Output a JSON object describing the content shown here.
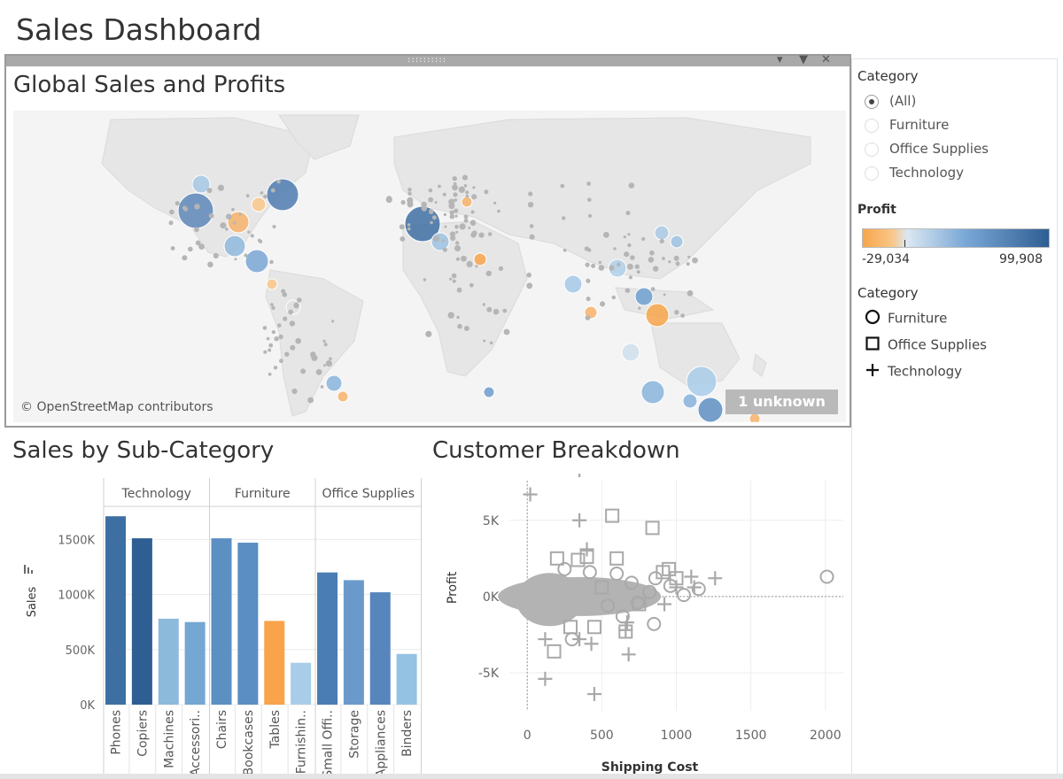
{
  "dashboard": {
    "title": "Sales Dashboard"
  },
  "map_pane": {
    "title": "Global Sales and Profits",
    "credit": "© OpenStreetMap contributors",
    "unknown_badge": "1 unknown",
    "grip": "::::::::::",
    "icons": [
      "dropdown-arrow-icon",
      "filter-icon",
      "close-icon"
    ]
  },
  "filters": {
    "category_heading": "Category",
    "options": [
      {
        "label": "(All)",
        "selected": true
      },
      {
        "label": "Furniture",
        "selected": false
      },
      {
        "label": "Office Supplies",
        "selected": false
      },
      {
        "label": "Technology",
        "selected": false
      }
    ]
  },
  "profit_legend": {
    "heading": "Profit",
    "min_label": "-29,034",
    "max_label": "99,908",
    "colors": [
      "#f7a54a",
      "#dbe7f2",
      "#2f5e93"
    ]
  },
  "shape_legend": {
    "heading": "Category",
    "items": [
      {
        "label": "Furniture",
        "shape": "circle-icon"
      },
      {
        "label": "Office Supplies",
        "shape": "square-icon"
      },
      {
        "label": "Technology",
        "shape": "plus-icon"
      }
    ]
  },
  "bar_section": {
    "title": "Sales by Sub-Category"
  },
  "scatter_section": {
    "title": "Customer Breakdown"
  },
  "chart_data": [
    {
      "type": "bar",
      "ylabel": "Sales",
      "ylim": [
        0,
        1800000
      ],
      "y_ticks": [
        {
          "value": 0,
          "label": "0K"
        },
        {
          "value": 500000,
          "label": "500K"
        },
        {
          "value": 1000000,
          "label": "1000K"
        },
        {
          "value": 1500000,
          "label": "1500K"
        }
      ],
      "groups": [
        {
          "name": "Technology",
          "items": [
            {
              "label": "Phones",
              "value": 1710000,
              "color": "#3e6fa3"
            },
            {
              "label": "Copiers",
              "value": 1510000,
              "color": "#2f5e93"
            },
            {
              "label": "Machines",
              "value": 780000,
              "color": "#8cbadb"
            },
            {
              "label": "Accessori..",
              "value": 750000,
              "color": "#74a7d2"
            }
          ]
        },
        {
          "name": "Furniture",
          "items": [
            {
              "label": "Chairs",
              "value": 1510000,
              "color": "#5c8fc2"
            },
            {
              "label": "Bookcases",
              "value": 1470000,
              "color": "#5b8ec2"
            },
            {
              "label": "Tables",
              "value": 760000,
              "color": "#f9a34b"
            },
            {
              "label": "Furnishin..",
              "value": 380000,
              "color": "#a9cde8"
            }
          ]
        },
        {
          "name": "Office Supplies",
          "items": [
            {
              "label": "Small Offi..",
              "value": 1200000,
              "color": "#4a7db3"
            },
            {
              "label": "Storage",
              "value": 1130000,
              "color": "#6a9acb"
            },
            {
              "label": "Appliances",
              "value": 1020000,
              "color": "#5786bd"
            },
            {
              "label": "Binders",
              "value": 460000,
              "color": "#94c2e3"
            }
          ]
        }
      ]
    },
    {
      "type": "scatter",
      "xlabel": "Shipping Cost",
      "ylabel": "Profit",
      "xlim": [
        -120,
        2120
      ],
      "ylim": [
        -7500,
        7600
      ],
      "x_ticks": [
        {
          "value": 0,
          "label": "0"
        },
        {
          "value": 500,
          "label": "500"
        },
        {
          "value": 1000,
          "label": "1000"
        },
        {
          "value": 1500,
          "label": "1500"
        },
        {
          "value": 2000,
          "label": "2000"
        }
      ],
      "y_ticks": [
        {
          "value": 5000,
          "label": "5K"
        },
        {
          "value": 0,
          "label": "0K"
        },
        {
          "value": -5000,
          "label": "-5K"
        }
      ],
      "series": [
        {
          "name": "Furniture",
          "shape": "circle",
          "points": [
            [
              2010,
              1300
            ],
            [
              960,
              700
            ],
            [
              1150,
              500
            ],
            [
              860,
              1200
            ],
            [
              740,
              -400
            ],
            [
              850,
              -1800
            ],
            [
              540,
              -600
            ],
            [
              640,
              -1300
            ],
            [
              300,
              -2800
            ],
            [
              250,
              1800
            ],
            [
              420,
              1600
            ],
            [
              700,
              900
            ],
            [
              820,
              300
            ],
            [
              1050,
              100
            ],
            [
              600,
              1500
            ]
          ]
        },
        {
          "name": "Office Supplies",
          "shape": "square",
          "points": [
            [
              570,
              5300
            ],
            [
              840,
              4500
            ],
            [
              400,
              2600
            ],
            [
              200,
              2500
            ],
            [
              600,
              2500
            ],
            [
              1000,
              1200
            ],
            [
              910,
              1600
            ],
            [
              950,
              1800
            ],
            [
              290,
              -2000
            ],
            [
              180,
              -3600
            ],
            [
              450,
              -2000
            ],
            [
              750,
              -500
            ],
            [
              660,
              -2300
            ],
            [
              340,
              2400
            ],
            [
              500,
              600
            ]
          ]
        },
        {
          "name": "Technology",
          "shape": "plus",
          "points": [
            [
              350,
              8300
            ],
            [
              20,
              6700
            ],
            [
              350,
              5000
            ],
            [
              400,
              3100
            ],
            [
              1000,
              600
            ],
            [
              1100,
              1300
            ],
            [
              1260,
              1200
            ],
            [
              1120,
              600
            ],
            [
              660,
              -2200
            ],
            [
              670,
              -1700
            ],
            [
              680,
              -3800
            ],
            [
              430,
              -3100
            ],
            [
              350,
              -2800
            ],
            [
              120,
              -2800
            ],
            [
              120,
              -5400
            ],
            [
              450,
              -6400
            ],
            [
              920,
              -500
            ]
          ]
        }
      ]
    }
  ]
}
